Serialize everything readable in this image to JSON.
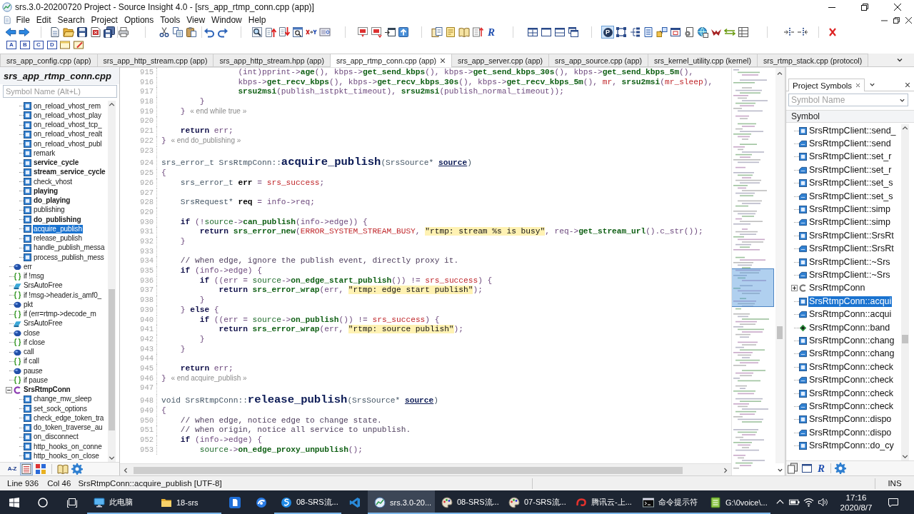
{
  "window": {
    "title": "srs.3.0-20200720 Project - Source Insight 4.0 - [srs_app_rtmp_conn.cpp (app)]"
  },
  "menu": [
    "File",
    "Edit",
    "Search",
    "Project",
    "Options",
    "Tools",
    "View",
    "Window",
    "Help"
  ],
  "toolbar": {
    "groups": [
      {
        "buttons": [
          {
            "kind": "back",
            "pressed": false
          },
          {
            "kind": "forward",
            "pressed": false
          }
        ]
      },
      {
        "buttons": [
          {
            "kind": "new",
            "pressed": false
          },
          {
            "kind": "open",
            "pressed": false
          },
          {
            "kind": "save",
            "pressed": false
          },
          {
            "kind": "close",
            "pressed": false
          },
          {
            "kind": "save-all",
            "pressed": false
          }
        ]
      },
      {
        "buttons": [
          {
            "kind": "print",
            "pressed": false
          }
        ]
      },
      {
        "buttons": [
          {
            "kind": "cut",
            "pressed": false
          },
          {
            "kind": "copy",
            "pressed": false
          },
          {
            "kind": "paste",
            "pressed": false
          }
        ]
      },
      {
        "buttons": [
          {
            "kind": "undo",
            "pressed": false
          },
          {
            "kind": "redo",
            "pressed": false
          }
        ]
      },
      {
        "buttons": [
          {
            "kind": "find",
            "pressed": false
          },
          {
            "kind": "find-previous",
            "pressed": false
          },
          {
            "kind": "find-next",
            "pressed": false
          },
          {
            "kind": "search-files",
            "pressed": false
          },
          {
            "kind": "replace",
            "pressed": false
          },
          {
            "kind": "lookup",
            "pressed": false
          }
        ]
      },
      {
        "buttons": [
          {
            "kind": "bookmark",
            "pressed": false
          },
          {
            "kind": "bookmark-next",
            "pressed": false
          },
          {
            "kind": "window-arrow",
            "pressed": false
          },
          {
            "kind": "upload",
            "pressed": false
          }
        ]
      },
      {
        "buttons": [
          {
            "kind": "panel",
            "pressed": false
          },
          {
            "kind": "notes",
            "pressed": false
          },
          {
            "kind": "book",
            "pressed": false
          },
          {
            "kind": "sort",
            "pressed": false
          },
          {
            "kind": "glyph",
            "text": "R",
            "pressed": false
          }
        ]
      },
      {
        "buttons": [
          {
            "kind": "tile",
            "pressed": false
          },
          {
            "kind": "window",
            "pressed": false
          },
          {
            "kind": "split",
            "pressed": false
          },
          {
            "kind": "cascade",
            "pressed": false
          }
        ]
      },
      {
        "buttons": [
          {
            "kind": "badge",
            "text": "P",
            "pressed": true
          },
          {
            "kind": "frame",
            "pressed": false
          },
          {
            "kind": "tree",
            "pressed": false
          },
          {
            "kind": "document",
            "pressed": false
          },
          {
            "kind": "move",
            "pressed": false
          },
          {
            "kind": "dialog",
            "pressed": false
          },
          {
            "kind": "gear-document",
            "pressed": false
          },
          {
            "kind": "globe",
            "pressed": false
          },
          {
            "kind": "bird",
            "pressed": false
          },
          {
            "kind": "double-arrow",
            "pressed": false
          },
          {
            "kind": "table",
            "pressed": false
          }
        ]
      },
      {
        "buttons": [
          {
            "kind": "indent",
            "pressed": false
          },
          {
            "kind": "outdent",
            "pressed": false
          }
        ]
      },
      {
        "buttons": [
          {
            "kind": "delete",
            "pressed": false
          }
        ]
      }
    ]
  },
  "toolbar_2": {
    "buttons": [
      {
        "kind": "letter",
        "text": "A"
      },
      {
        "kind": "letter",
        "text": "B"
      },
      {
        "kind": "letter",
        "text": "C"
      },
      {
        "kind": "letter",
        "text": "D"
      },
      {
        "kind": "window-folder"
      },
      {
        "kind": "edit"
      }
    ]
  },
  "file_tabs": [
    {
      "label": "srs_app_config.cpp (app)",
      "selected": false
    },
    {
      "label": "srs_app_http_stream.cpp (app)",
      "selected": false
    },
    {
      "label": "srs_app_http_stream.hpp (app)",
      "selected": false
    },
    {
      "label": "srs_app_rtmp_conn.cpp (app)",
      "selected": true
    },
    {
      "label": "srs_app_server.cpp (app)",
      "selected": false
    },
    {
      "label": "srs_app_source.cpp (app)",
      "selected": false
    },
    {
      "label": "srs_kernel_utility.cpp (kernel)",
      "selected": false
    },
    {
      "label": "srs_rtmp_stack.cpp (protocol)",
      "selected": false
    }
  ],
  "symbol_panel": {
    "title": "srs_app_rtmp_conn.cpp",
    "search": {
      "placeholder": "Symbol Name (Alt+L)"
    },
    "tree": [
      {
        "children": [
          {
            "kind": "method",
            "label": "on_reload_vhost_rem",
            "bold": false,
            "selected": false
          },
          {
            "kind": "method",
            "label": "on_reload_vhost_play",
            "bold": false,
            "selected": false
          },
          {
            "kind": "method",
            "label": "on_reload_vhost_tcp_",
            "bold": false,
            "selected": false
          },
          {
            "kind": "method",
            "label": "on_reload_vhost_realt",
            "bold": false,
            "selected": false
          },
          {
            "kind": "method",
            "label": "on_reload_vhost_publ",
            "bold": false,
            "selected": false
          },
          {
            "kind": "method",
            "label": "remark",
            "bold": false,
            "selected": false
          },
          {
            "kind": "method",
            "label": "service_cycle",
            "bold": true,
            "selected": false
          },
          {
            "kind": "method",
            "label": "stream_service_cycle",
            "bold": true,
            "selected": false
          },
          {
            "kind": "method",
            "label": "check_vhost",
            "bold": false,
            "selected": false
          },
          {
            "kind": "method",
            "label": "playing",
            "bold": true,
            "selected": false
          },
          {
            "kind": "method",
            "label": "do_playing",
            "bold": true,
            "selected": false
          },
          {
            "kind": "method",
            "label": "publishing",
            "bold": false,
            "selected": false
          },
          {
            "kind": "method",
            "label": "do_publishing",
            "bold": true,
            "selected": false
          },
          {
            "kind": "method",
            "label": "acquire_publish",
            "bold": false,
            "selected": true
          },
          {
            "kind": "method",
            "label": "release_publish",
            "bold": false,
            "selected": false
          },
          {
            "kind": "method",
            "label": "handle_publish_messa",
            "bold": false,
            "selected": false
          },
          {
            "kind": "method",
            "label": "process_publish_mess",
            "bold": false,
            "selected": false
          }
        ]
      },
      {
        "kind": "variable",
        "label": "err",
        "bold": false,
        "selected": false
      },
      {
        "kind": "block",
        "label": "if !msg",
        "bold": false,
        "selected": false
      },
      {
        "kind": "object",
        "label": "SrsAutoFree",
        "bold": false,
        "selected": false
      },
      {
        "kind": "block",
        "label": "if !msg->header.is_amf0_",
        "bold": false,
        "selected": false
      },
      {
        "kind": "variable",
        "label": "pkt",
        "bold": false,
        "selected": false
      },
      {
        "kind": "block",
        "label": "if (err=rtmp->decode_m",
        "bold": false,
        "selected": false
      },
      {
        "kind": "object",
        "label": "SrsAutoFree",
        "bold": false,
        "selected": false
      },
      {
        "kind": "variable",
        "label": "close",
        "bold": false,
        "selected": false
      },
      {
        "kind": "block",
        "label": "if close",
        "bold": false,
        "selected": false
      },
      {
        "kind": "variable",
        "label": "call",
        "bold": false,
        "selected": false
      },
      {
        "kind": "block",
        "label": "if call",
        "bold": false,
        "selected": false
      },
      {
        "kind": "variable",
        "label": "pause",
        "bold": false,
        "selected": false
      },
      {
        "kind": "block",
        "label": "if pause",
        "bold": false,
        "selected": false
      },
      {
        "kind": "class",
        "label": "SrsRtmpConn",
        "bold": true,
        "selected": false,
        "expanded": true,
        "children": [
          {
            "kind": "method",
            "label": "change_mw_sleep",
            "bold": false,
            "selected": false
          },
          {
            "kind": "method",
            "label": "set_sock_options",
            "bold": false,
            "selected": false
          },
          {
            "kind": "method",
            "label": "check_edge_token_tra",
            "bold": false,
            "selected": false
          },
          {
            "kind": "method",
            "label": "do_token_traverse_au",
            "bold": false,
            "selected": false
          },
          {
            "kind": "method",
            "label": "on_disconnect",
            "bold": false,
            "selected": false
          },
          {
            "kind": "method",
            "label": "http_hooks_on_conne",
            "bold": false,
            "selected": false
          },
          {
            "kind": "method",
            "label": "http_hooks_on_close",
            "bold": false,
            "selected": false
          }
        ]
      }
    ],
    "toolbar": {
      "groups": [
        {
          "buttons": [
            {
              "kind": "glyph",
              "text": "A-Z",
              "pressed": false
            },
            {
              "kind": "list",
              "pressed": true
            },
            {
              "kind": "blocks",
              "pressed": false
            }
          ]
        },
        {
          "buttons": [
            {
              "kind": "book",
              "pressed": false
            },
            {
              "kind": "gear",
              "pressed": false
            }
          ]
        }
      ]
    }
  },
  "editor": {
    "lines": [
      {
        "number": "915",
        "tokens": [
          {
            "kind": "plain",
            "text": "                (int)pprint->"
          },
          {
            "kind": "call",
            "text": "age"
          },
          {
            "kind": "plain",
            "text": "(), kbps->"
          },
          {
            "kind": "call",
            "text": "get_send_kbps"
          },
          {
            "kind": "plain",
            "text": "(), kbps->"
          },
          {
            "kind": "call",
            "text": "get_send_kbps_30s"
          },
          {
            "kind": "plain",
            "text": "(), kbps->"
          },
          {
            "kind": "call",
            "text": "get_send_kbps_5m"
          },
          {
            "kind": "plain",
            "text": "(),"
          }
        ]
      },
      {
        "number": "916",
        "tokens": [
          {
            "kind": "plain",
            "text": "                kbps->"
          },
          {
            "kind": "call",
            "text": "get_recv_kbps"
          },
          {
            "kind": "plain",
            "text": "(), kbps->"
          },
          {
            "kind": "call",
            "text": "get_recv_kbps_30s"
          },
          {
            "kind": "plain",
            "text": "(), kbps->"
          },
          {
            "kind": "call",
            "text": "get_recv_kbps_5m"
          },
          {
            "kind": "plain",
            "text": "(), "
          },
          {
            "kind": "constant",
            "text": "mr"
          },
          {
            "kind": "plain",
            "text": ", "
          },
          {
            "kind": "call",
            "text": "srsu2msi"
          },
          {
            "kind": "plain",
            "text": "("
          },
          {
            "kind": "constant",
            "text": "mr_sleep"
          },
          {
            "kind": "plain",
            "text": "),"
          }
        ]
      },
      {
        "number": "917",
        "tokens": [
          {
            "kind": "call",
            "text": "                srsu2msi"
          },
          {
            "kind": "plain",
            "text": "(publish_1stpkt_timeout), "
          },
          {
            "kind": "call",
            "text": "srsu2msi"
          },
          {
            "kind": "plain",
            "text": "(publish_normal_timeout));"
          }
        ]
      },
      {
        "number": "918",
        "tokens": [
          {
            "kind": "plain",
            "text": "        }"
          }
        ]
      },
      {
        "number": "919",
        "tokens": [
          {
            "kind": "plain",
            "text": "    } "
          },
          {
            "kind": "marker",
            "text": "« end while true »"
          }
        ]
      },
      {
        "number": "920"
      },
      {
        "number": "921",
        "tokens": [
          {
            "kind": "keyword",
            "text": "    return"
          },
          {
            "kind": "plain",
            "text": " err;"
          }
        ]
      },
      {
        "number": "922",
        "tokens": [
          {
            "kind": "plain",
            "text": "} "
          },
          {
            "kind": "marker",
            "text": "« end do_publishing »"
          }
        ]
      },
      {
        "number": "923"
      },
      {
        "number": "924",
        "tokens": [
          {
            "kind": "type",
            "text": "srs_error_t SrsRtmpConn::"
          },
          {
            "kind": "definition",
            "text": "acquire_publish"
          },
          {
            "kind": "type",
            "text": "(SrsSource* "
          },
          {
            "kind": "parameter",
            "text": "source"
          },
          {
            "kind": "type",
            "text": ")"
          }
        ]
      },
      {
        "number": "925",
        "tokens": [
          {
            "kind": "plain",
            "text": "{"
          }
        ]
      },
      {
        "number": "926",
        "tokens": [
          {
            "kind": "type",
            "text": "    srs_error_t "
          },
          {
            "kind": "declaration",
            "text": "err"
          },
          {
            "kind": "plain",
            "text": " = "
          },
          {
            "kind": "constant",
            "text": "srs_success"
          },
          {
            "kind": "plain",
            "text": ";"
          }
        ]
      },
      {
        "number": "927"
      },
      {
        "number": "928",
        "tokens": [
          {
            "kind": "type",
            "text": "    SrsRequest* "
          },
          {
            "kind": "declaration",
            "text": "req"
          },
          {
            "kind": "plain",
            "text": " = info->req;"
          }
        ]
      },
      {
        "number": "929"
      },
      {
        "number": "930",
        "tokens": [
          {
            "kind": "keyword",
            "text": "    if"
          },
          {
            "kind": "plain",
            "text": " (!"
          },
          {
            "kind": "reference",
            "text": "source"
          },
          {
            "kind": "plain",
            "text": "->"
          },
          {
            "kind": "call",
            "text": "can_publish"
          },
          {
            "kind": "plain",
            "text": "(info->edge)) {"
          }
        ]
      },
      {
        "number": "931",
        "tokens": [
          {
            "kind": "keyword",
            "text": "        return "
          },
          {
            "kind": "call",
            "text": "srs_error_new"
          },
          {
            "kind": "plain",
            "text": "("
          },
          {
            "kind": "constant",
            "text": "ERROR_SYSTEM_STREAM_BUSY"
          },
          {
            "kind": "plain",
            "text": ", "
          },
          {
            "kind": "string",
            "text": "\"rtmp: stream %s is busy\""
          },
          {
            "kind": "plain",
            "text": ", req->"
          },
          {
            "kind": "call",
            "text": "get_stream_url"
          },
          {
            "kind": "plain",
            "text": "().c_str());"
          }
        ]
      },
      {
        "number": "932",
        "tokens": [
          {
            "kind": "plain",
            "text": "    }"
          }
        ]
      },
      {
        "number": "933"
      },
      {
        "number": "934",
        "tokens": [
          {
            "kind": "comment",
            "text": "    // when edge, ignore the publish event, directly proxy it."
          }
        ]
      },
      {
        "number": "935",
        "tokens": [
          {
            "kind": "keyword",
            "text": "    if"
          },
          {
            "kind": "plain",
            "text": " (info->edge) {"
          }
        ]
      },
      {
        "number": "936",
        "tokens": [
          {
            "kind": "keyword",
            "text": "        if"
          },
          {
            "kind": "plain",
            "text": " ((err = "
          },
          {
            "kind": "reference",
            "text": "source"
          },
          {
            "kind": "plain",
            "text": "->"
          },
          {
            "kind": "call",
            "text": "on_edge_start_publish"
          },
          {
            "kind": "plain",
            "text": "()) != "
          },
          {
            "kind": "constant",
            "text": "srs_success"
          },
          {
            "kind": "plain",
            "text": ") {"
          }
        ]
      },
      {
        "number": "937",
        "tokens": [
          {
            "kind": "keyword",
            "text": "            return "
          },
          {
            "kind": "call",
            "text": "srs_error_wrap"
          },
          {
            "kind": "plain",
            "text": "(err, "
          },
          {
            "kind": "string",
            "text": "\"rtmp: edge start publish\""
          },
          {
            "kind": "plain",
            "text": ");"
          }
        ]
      },
      {
        "number": "938",
        "tokens": [
          {
            "kind": "plain",
            "text": "        }"
          }
        ]
      },
      {
        "number": "939",
        "tokens": [
          {
            "kind": "plain",
            "text": "    } "
          },
          {
            "kind": "keyword",
            "text": "else"
          },
          {
            "kind": "plain",
            "text": " {"
          }
        ]
      },
      {
        "number": "940",
        "tokens": [
          {
            "kind": "keyword",
            "text": "        if"
          },
          {
            "kind": "plain",
            "text": " ((err = "
          },
          {
            "kind": "reference",
            "text": "source"
          },
          {
            "kind": "plain",
            "text": "->"
          },
          {
            "kind": "call",
            "text": "on_publish"
          },
          {
            "kind": "plain",
            "text": "()) != "
          },
          {
            "kind": "constant",
            "text": "srs_success"
          },
          {
            "kind": "plain",
            "text": ") {"
          }
        ]
      },
      {
        "number": "941",
        "tokens": [
          {
            "kind": "keyword",
            "text": "            return "
          },
          {
            "kind": "call",
            "text": "srs_error_wrap"
          },
          {
            "kind": "plain",
            "text": "(err, "
          },
          {
            "kind": "string",
            "text": "\"rtmp: source publish\""
          },
          {
            "kind": "plain",
            "text": ");"
          }
        ]
      },
      {
        "number": "942",
        "tokens": [
          {
            "kind": "plain",
            "text": "        }"
          }
        ]
      },
      {
        "number": "943",
        "tokens": [
          {
            "kind": "plain",
            "text": "    }"
          }
        ]
      },
      {
        "number": "944"
      },
      {
        "number": "945",
        "tokens": [
          {
            "kind": "keyword",
            "text": "    return"
          },
          {
            "kind": "plain",
            "text": " err;"
          }
        ]
      },
      {
        "number": "946",
        "tokens": [
          {
            "kind": "plain",
            "text": "} "
          },
          {
            "kind": "marker",
            "text": "« end acquire_publish »"
          }
        ]
      },
      {
        "number": "947"
      },
      {
        "number": "948",
        "tokens": [
          {
            "kind": "type",
            "text": "void SrsRtmpConn::"
          },
          {
            "kind": "definition",
            "text": "release_publish"
          },
          {
            "kind": "type",
            "text": "(SrsSource* "
          },
          {
            "kind": "parameter",
            "text": "source"
          },
          {
            "kind": "type",
            "text": ")"
          }
        ]
      },
      {
        "number": "949",
        "tokens": [
          {
            "kind": "plain",
            "text": "{"
          }
        ]
      },
      {
        "number": "950",
        "tokens": [
          {
            "kind": "comment",
            "text": "    // when edge, notice edge to change state."
          }
        ]
      },
      {
        "number": "951",
        "tokens": [
          {
            "kind": "comment",
            "text": "    // when origin, notice all service to unpublish."
          }
        ]
      },
      {
        "number": "952",
        "tokens": [
          {
            "kind": "keyword",
            "text": "    if"
          },
          {
            "kind": "plain",
            "text": " (info->edge) {"
          }
        ]
      },
      {
        "number": "953",
        "tokens": [
          {
            "kind": "reference",
            "text": "        source"
          },
          {
            "kind": "plain",
            "text": "->"
          },
          {
            "kind": "call",
            "text": "on_edge_proxy_unpublish"
          },
          {
            "kind": "plain",
            "text": "();"
          }
        ]
      }
    ]
  },
  "project_symbols": {
    "tab": "Project Symbols",
    "search": {
      "placeholder": "Symbol Name"
    },
    "column": "Symbol",
    "items": [
      {
        "kind": "method",
        "label": "SrsRtmpClient::send_",
        "selected": false
      },
      {
        "kind": "declaration",
        "label": "SrsRtmpClient::send",
        "selected": false
      },
      {
        "kind": "method",
        "label": "SrsRtmpClient::set_r",
        "selected": false
      },
      {
        "kind": "declaration",
        "label": "SrsRtmpClient::set_r",
        "selected": false
      },
      {
        "kind": "method",
        "label": "SrsRtmpClient::set_s",
        "selected": false
      },
      {
        "kind": "declaration",
        "label": "SrsRtmpClient::set_s",
        "selected": false
      },
      {
        "kind": "method",
        "label": "SrsRtmpClient::simp",
        "selected": false
      },
      {
        "kind": "declaration",
        "label": "SrsRtmpClient::simp",
        "selected": false
      },
      {
        "kind": "method",
        "label": "SrsRtmpClient::SrsRt",
        "selected": false
      },
      {
        "kind": "declaration",
        "label": "SrsRtmpClient::SrsRt",
        "selected": false
      },
      {
        "kind": "method",
        "label": "SrsRtmpClient::~Srs",
        "selected": false
      },
      {
        "kind": "declaration",
        "label": "SrsRtmpClient::~Srs",
        "selected": false
      },
      {
        "kind": "class",
        "label": "SrsRtmpConn",
        "selected": false,
        "expanded": false
      },
      {
        "kind": "method",
        "label": "SrsRtmpConn::acqui",
        "selected": true
      },
      {
        "kind": "declaration",
        "label": "SrsRtmpConn::acqui",
        "selected": false
      },
      {
        "kind": "function",
        "label": "SrsRtmpConn::band",
        "selected": false
      },
      {
        "kind": "method",
        "label": "SrsRtmpConn::chang",
        "selected": false
      },
      {
        "kind": "declaration",
        "label": "SrsRtmpConn::chang",
        "selected": false
      },
      {
        "kind": "method",
        "label": "SrsRtmpConn::check",
        "selected": false
      },
      {
        "kind": "declaration",
        "label": "SrsRtmpConn::check",
        "selected": false
      },
      {
        "kind": "method",
        "label": "SrsRtmpConn::check",
        "selected": false
      },
      {
        "kind": "declaration",
        "label": "SrsRtmpConn::check",
        "selected": false
      },
      {
        "kind": "method",
        "label": "SrsRtmpConn::dispo",
        "selected": false
      },
      {
        "kind": "declaration",
        "label": "SrsRtmpConn::dispo",
        "selected": false
      },
      {
        "kind": "method",
        "label": "SrsRtmpConn::do_cy",
        "selected": false
      }
    ],
    "toolbar": {
      "groups": [
        {
          "buttons": [
            {
              "kind": "stack"
            },
            {
              "kind": "window"
            },
            {
              "kind": "glyph",
              "text": "R"
            }
          ]
        },
        {
          "buttons": [
            {
              "kind": "gear"
            }
          ]
        }
      ]
    }
  },
  "status_bar": {
    "line": "Line 936",
    "column": "Col 46",
    "symbol": "SrsRtmpConn::acquire_publish [UTF-8]",
    "mode": "INS"
  },
  "taskbar": {
    "items": [
      {
        "kind": "computer",
        "label": "此电脑",
        "running": true,
        "selected": false
      },
      {
        "kind": "folder",
        "label": "18-srs",
        "running": true,
        "selected": false
      },
      {
        "kind": "document",
        "running": false,
        "selected": false
      },
      {
        "kind": "browser",
        "running": false,
        "selected": false
      },
      {
        "kind": "app",
        "label": "08-SRS流...",
        "running": true,
        "selected": false
      },
      {
        "kind": "editor",
        "running": false,
        "selected": false
      },
      {
        "kind": "insight",
        "label": "srs.3.0-20...",
        "running": true,
        "selected": true
      },
      {
        "kind": "palette",
        "label": "08-SRS流...",
        "running": true,
        "selected": false
      },
      {
        "kind": "palette",
        "label": "07-SRS流...",
        "running": true,
        "selected": false
      },
      {
        "kind": "cloud",
        "label": "腾讯云-上...",
        "running": true,
        "selected": false
      },
      {
        "kind": "console",
        "label": "命令提示符",
        "running": true,
        "selected": false
      },
      {
        "kind": "notepad",
        "label": "G:\\0voice\\...",
        "running": true,
        "selected": false
      }
    ],
    "clock": {
      "time": "17:16",
      "date": "2020/8/7"
    }
  }
}
